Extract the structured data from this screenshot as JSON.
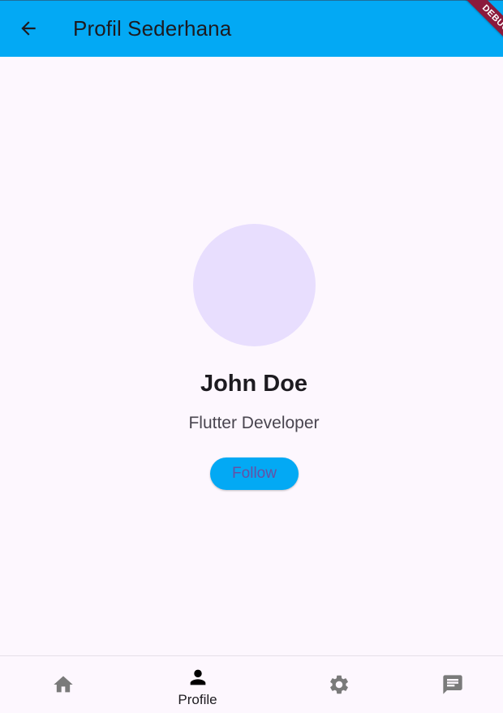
{
  "appbar": {
    "title": "Profil Sederhana",
    "background": "#03a9f4",
    "back_icon": "arrow-back-icon"
  },
  "debug_banner": {
    "label": "DEBUG",
    "color": "#8b1a3c"
  },
  "profile": {
    "name": "John Doe",
    "role": "Flutter Developer",
    "avatar_color": "#e8defe",
    "follow_label": "Follow"
  },
  "bottom_nav": {
    "items": [
      {
        "icon": "home-icon",
        "label": "",
        "selected": false
      },
      {
        "icon": "person-icon",
        "label": "Profile",
        "selected": true
      },
      {
        "icon": "gear-icon",
        "label": "",
        "selected": false
      },
      {
        "icon": "chat-icon",
        "label": "",
        "selected": false
      }
    ]
  }
}
